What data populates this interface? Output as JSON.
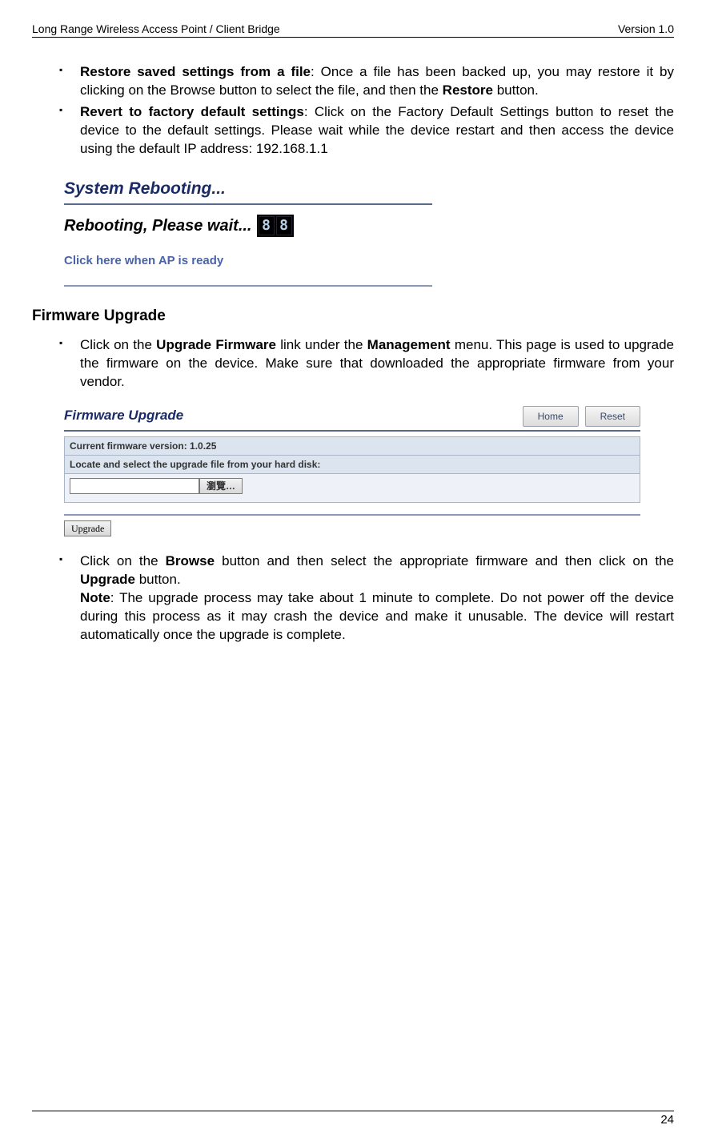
{
  "header": {
    "left": "Long Range Wireless Access Point / Client Bridge",
    "right": "Version 1.0"
  },
  "footer": {
    "pagenum": "24"
  },
  "bullets_top": [
    {
      "lead": "Restore saved settings from a file",
      "body": ": Once a file has been backed up, you may restore it by clicking on the Browse button to select the file, and then the ",
      "tail_bold": "Restore",
      "tail": " button."
    },
    {
      "lead": "Revert to factory default settings",
      "body": ": Click on the Factory Default Settings button to reset the device to the default settings. Please wait while the device restart and then access the device using the default IP address: 192.168.1.1",
      "tail_bold": "",
      "tail": ""
    }
  ],
  "shot1": {
    "title": "System Rebooting...",
    "msg": "Rebooting, Please wait...",
    "digit1": "8",
    "digit2": "8",
    "link": "Click here when AP is ready"
  },
  "section_title": "Firmware Upgrade",
  "bullet_mid": {
    "pre": "Click on the ",
    "b1": "Upgrade Firmware",
    "mid": " link under the ",
    "b2": "Management",
    "post": " menu. This page is used to upgrade the firmware on the device. Make sure that downloaded the appropriate firmware from your vendor."
  },
  "shot2": {
    "title": "Firmware Upgrade",
    "home": "Home",
    "reset": "Reset",
    "row1": "Current firmware version: 1.0.25",
    "row2": "Locate and select the upgrade file from your hard disk:",
    "browse": "瀏覽…",
    "upgrade": "Upgrade"
  },
  "bullet_bot": {
    "pre": "Click on the ",
    "b1": "Browse",
    "mid": " button and then select the appropriate firmware and then click on the ",
    "b2": "Upgrade",
    "post": " button.",
    "note_lead": "Note",
    "note": ": The upgrade process may take about 1 minute to complete. Do not power off the device during this process as it may crash the device and make it unusable. The device will restart automatically once the upgrade is complete."
  }
}
